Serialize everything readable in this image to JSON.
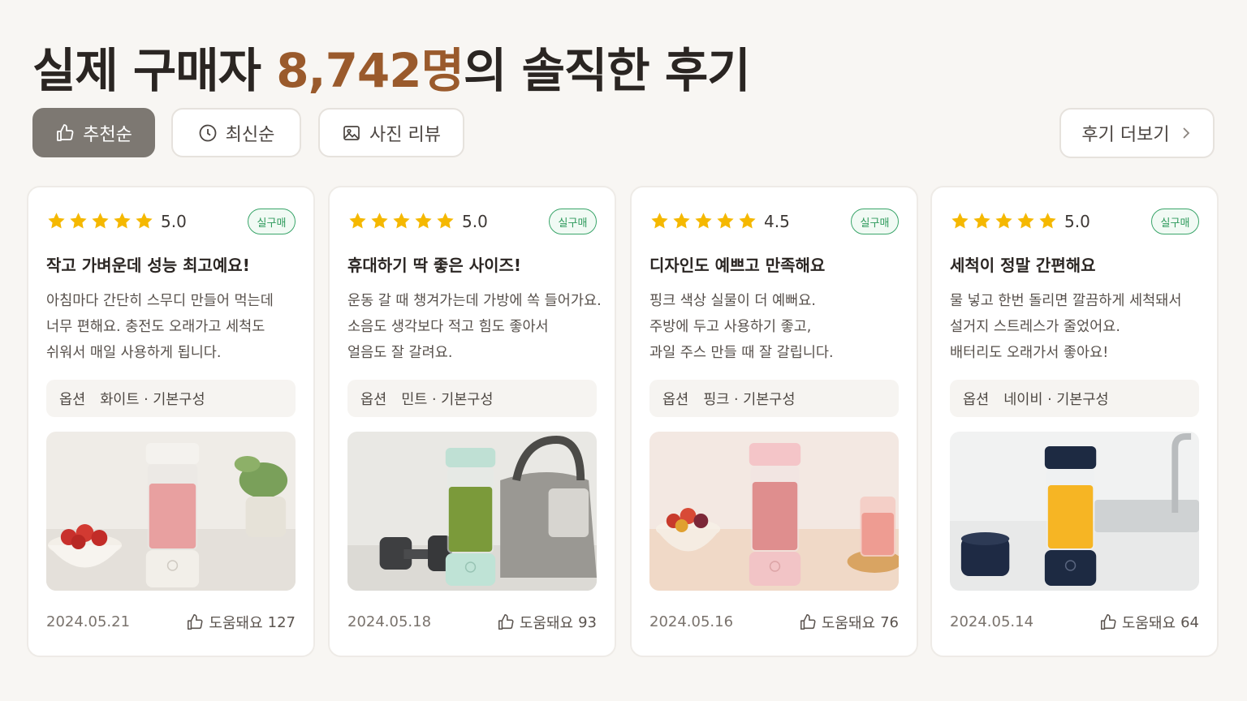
{
  "header": {
    "title_prefix": "실제 구매자 ",
    "title_count": "8,742명",
    "title_suffix": "의 솔직한 후기"
  },
  "filters": [
    {
      "label": "추천순",
      "icon": "thumbs-up-icon",
      "active": true
    },
    {
      "label": "최신순",
      "icon": "clock-icon",
      "active": false
    },
    {
      "label": "사진 리뷰",
      "icon": "image-icon",
      "active": false
    }
  ],
  "more_button": {
    "label": "후기 더보기",
    "icon": "chevron-right-icon"
  },
  "verified_label": "실구매",
  "option_label": "옵션",
  "helpful_label": "도움돼요",
  "colors": {
    "accent": "#9a5a2c",
    "verified_green": "#2e9a5c",
    "star": "#f5b800",
    "active_chip": "#7d7872"
  },
  "reviews": [
    {
      "rating": "5.0",
      "stars": 5,
      "title": "작고 가벼운데 성능 최고예요!",
      "body": [
        "아침마다 간단히 스무디 만들어 먹는데",
        "너무 편해요. 충전도 오래가고 세척도",
        "쉬워서 매일 사용하게 됩니다."
      ],
      "option": "화이트 · 기본구성",
      "photo": "white-blender-strawberry-smoothie",
      "date": "2024.05.21",
      "helpful_count": "127"
    },
    {
      "rating": "5.0",
      "stars": 5,
      "title": "휴대하기 딱 좋은 사이즈!",
      "body": [
        "운동 갈 때 챙겨가는데 가방에 쏙 들어가요.",
        "소음도 생각보다 적고 힘도 좋아서",
        "얼음도 잘 갈려요."
      ],
      "option": "민트 · 기본구성",
      "photo": "mint-blender-green-smoothie-gym",
      "date": "2024.05.18",
      "helpful_count": "93"
    },
    {
      "rating": "4.5",
      "stars": 4.5,
      "title": "디자인도 예쁘고 만족해요",
      "body": [
        "핑크 색상 실물이 더 예뻐요.",
        "주방에 두고 사용하기 좋고,",
        "과일 주스 만들 때 잘 갈립니다."
      ],
      "option": "핑크 · 기본구성",
      "photo": "pink-blender-fruit-juice",
      "date": "2024.05.16",
      "helpful_count": "76"
    },
    {
      "rating": "5.0",
      "stars": 5,
      "title": "세척이 정말 간편해요",
      "body": [
        "물 넣고 한번 돌리면 깔끔하게 세척돼서",
        "설거지 스트레스가 줄었어요.",
        "배터리도 오래가서 좋아요!"
      ],
      "option": "네이비 · 기본구성",
      "photo": "navy-blender-orange-juice-sink",
      "date": "2024.05.14",
      "helpful_count": "64"
    }
  ]
}
